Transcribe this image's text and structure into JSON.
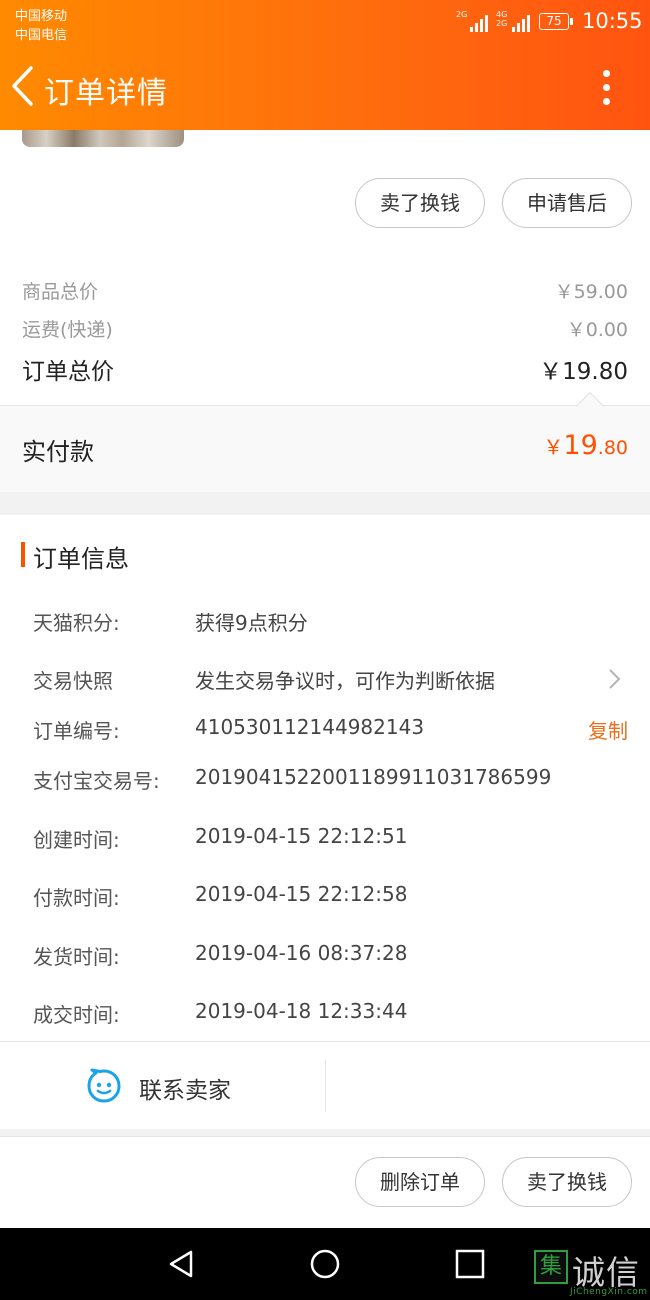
{
  "status_bar": {
    "carrier_1": "中国移动",
    "carrier_2": "中国电信",
    "network_1": "2G",
    "network_2a": "4G",
    "network_2b": "2G",
    "battery": "75",
    "time": "10:55"
  },
  "header": {
    "title": "订单详情",
    "back_icon": "chevron-left-icon",
    "more_icon": "more-vertical-icon",
    "accent_color": "#ff6d0e"
  },
  "item_actions": {
    "sell_label": "卖了换钱",
    "after_sale_label": "申请售后"
  },
  "price": {
    "goods_total_label": "商品总价",
    "goods_total_value": "￥59.00",
    "shipping_label": "运费(快递)",
    "shipping_value": "￥0.00",
    "order_total_label": "订单总价",
    "order_total_value": "￥19.80",
    "paid_label": "实付款",
    "paid_currency": "￥",
    "paid_integer": "19",
    "paid_decimal": ".80",
    "paid_color": "#ff5000"
  },
  "order_info": {
    "title": "订单信息",
    "rows": [
      {
        "label": "天猫积分:",
        "value": "获得9点积分"
      },
      {
        "label": "交易快照",
        "value": "发生交易争议时，可作为判断依据"
      },
      {
        "label": "订单编号:",
        "value": "410530112144982143",
        "action": "复制"
      },
      {
        "label": "支付宝交易号:",
        "value": "2019041522001189911031786599"
      },
      {
        "label": "创建时间:",
        "value": "2019-04-15 22:12:51"
      },
      {
        "label": "付款时间:",
        "value": "2019-04-15 22:12:58"
      },
      {
        "label": "发货时间:",
        "value": "2019-04-16 08:37:28"
      },
      {
        "label": "成交时间:",
        "value": "2019-04-18 12:33:44"
      }
    ]
  },
  "contact": {
    "label": "联系卖家",
    "icon": "chat-bubble-icon",
    "icon_color": "#1aa3e8"
  },
  "bottom_actions": {
    "delete_label": "删除订单",
    "sell_label": "卖了换钱"
  },
  "watermark": {
    "mark": "集",
    "text": "诚信",
    "sub": "JiChengXin.com"
  }
}
